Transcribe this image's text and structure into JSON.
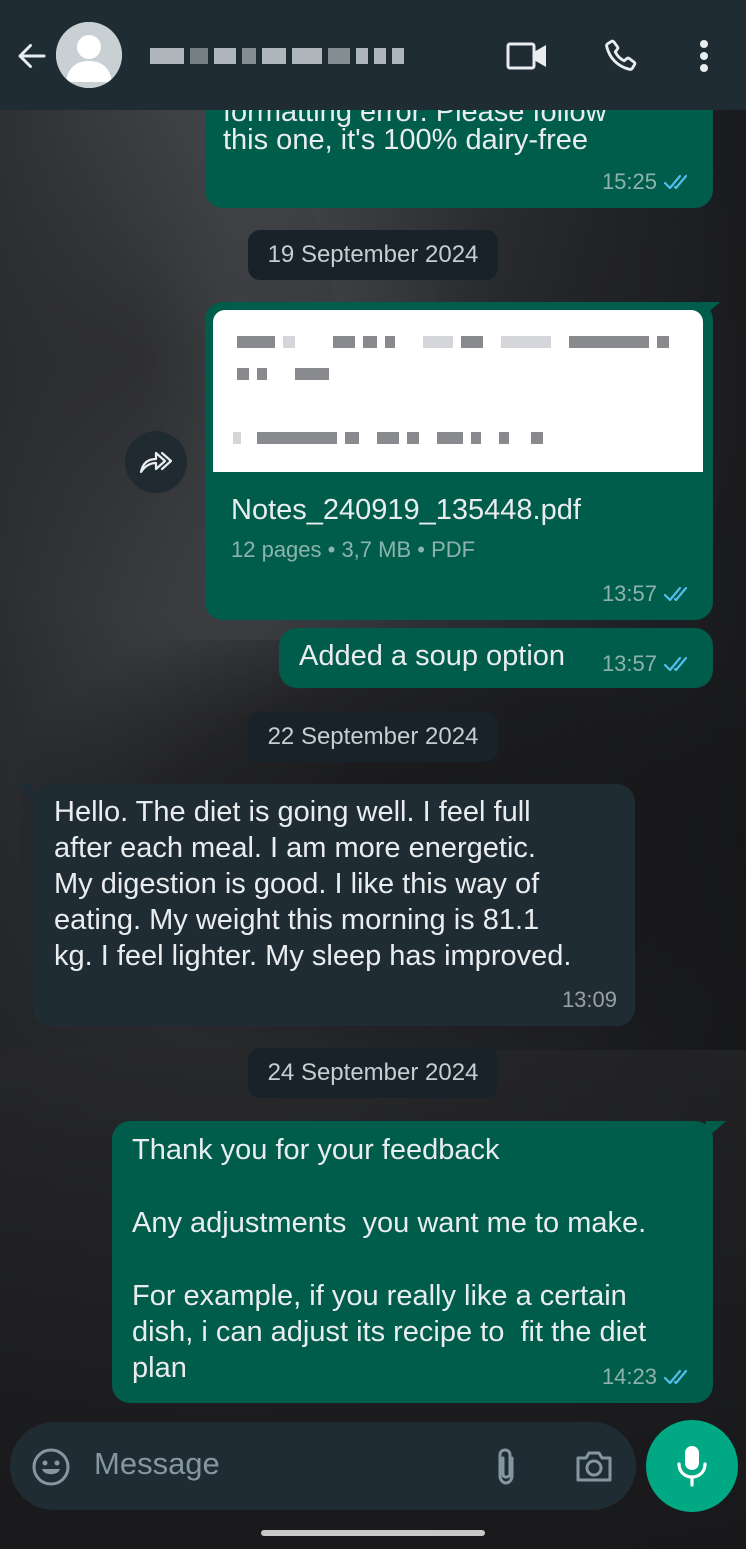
{
  "header": {
    "contact_name": ""
  },
  "messages": [
    {
      "id": "m1",
      "direction": "outgoing",
      "text_partial_top": "formatting error. Please follow",
      "text": "this one, it's 100% dairy-free",
      "time": "15:25",
      "status": "read"
    },
    {
      "id": "date1",
      "type": "date",
      "label": "19 September 2024"
    },
    {
      "id": "m2",
      "direction": "outgoing",
      "type": "document",
      "filename": "Notes_240919_135448.pdf",
      "meta": "12 pages • 3,7 MB • PDF",
      "time": "13:57",
      "status": "read"
    },
    {
      "id": "m3",
      "direction": "outgoing",
      "text": "Added a soup option",
      "time": "13:57",
      "status": "read"
    },
    {
      "id": "date2",
      "type": "date",
      "label": "22 September 2024"
    },
    {
      "id": "m4",
      "direction": "incoming",
      "lines": [
        "Hello. The diet is going well. I feel full",
        "after each meal. I am more energetic.",
        "My digestion is good. I like this way of",
        "eating. My weight this morning is 81.1",
        "kg. I feel lighter. My sleep has improved."
      ],
      "time": "13:09"
    },
    {
      "id": "date3",
      "type": "date",
      "label": "24 September 2024"
    },
    {
      "id": "m5",
      "direction": "outgoing",
      "lines": [
        "Thank you for your feedback",
        "",
        "Any adjustments  you want me to make.",
        "",
        "For example, if you really like a certain",
        "dish, i can adjust its recipe to  fit the diet",
        "plan"
      ],
      "time": "14:23",
      "status": "read"
    }
  ],
  "composer": {
    "placeholder": "Message"
  },
  "colors": {
    "header_bg": "#202c33",
    "outgoing_bubble": "#005c4b",
    "incoming_bubble": "#202c33",
    "read_tick": "#53bdeb",
    "mic_button": "#00a884"
  },
  "icons": {
    "back": "arrow-left-icon",
    "video": "video-call-icon",
    "call": "phone-icon",
    "menu": "more-vertical-icon",
    "forward": "forward-icon",
    "emoji": "emoji-icon",
    "attach": "paperclip-icon",
    "camera": "camera-icon",
    "mic": "microphone-icon"
  }
}
